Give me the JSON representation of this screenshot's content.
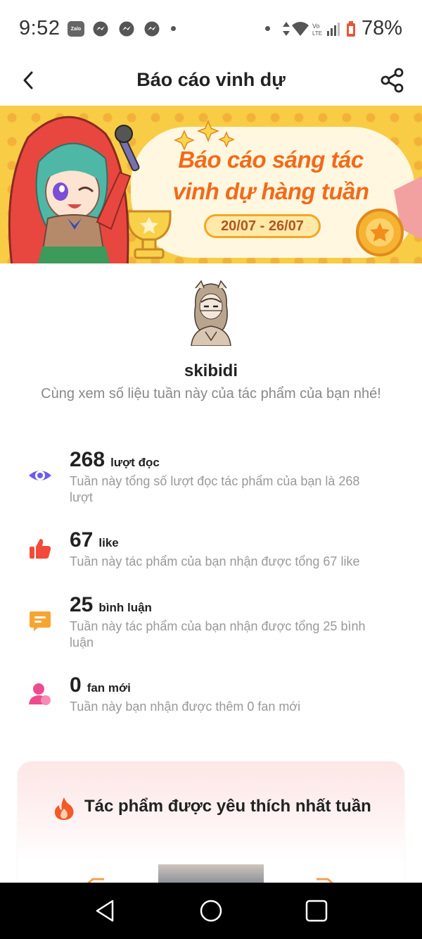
{
  "status_bar": {
    "time": "9:52",
    "battery": "78%",
    "notification_icons": [
      "zalo-icon",
      "messenger-icon",
      "messenger-icon",
      "messenger-icon"
    ],
    "zalo_label": "Zalo"
  },
  "header": {
    "title": "Báo cáo vinh dự"
  },
  "banner": {
    "title_line1": "Báo cáo sáng tác",
    "title_line2": "vinh dự hàng tuần",
    "date_range": "20/07 - 26/07"
  },
  "profile": {
    "username": "skibidi",
    "subtitle": "Cùng xem số liệu tuần này của tác phẩm của bạn nhé!"
  },
  "stats": [
    {
      "icon": "eye-icon",
      "value": "268",
      "unit": "lượt đọc",
      "description": "Tuần này tổng số lượt đọc tác phẩm của bạn là 268 lượt",
      "color": "#6b5cf0"
    },
    {
      "icon": "thumbs-up-icon",
      "value": "67",
      "unit": "like",
      "description": "Tuần này tác phẩm của bạn nhận được tổng 67 like",
      "color": "#f24b3c"
    },
    {
      "icon": "comment-icon",
      "value": "25",
      "unit": "bình luận",
      "description": "Tuần này tác phẩm của bạn nhận được tổng 25 bình luận",
      "color": "#f7a531"
    },
    {
      "icon": "user-icon",
      "value": "0",
      "unit": "fan mới",
      "description": "Tuần này bạn nhận được thêm 0 fan mới",
      "color": "#ec4c8c"
    }
  ],
  "favorite": {
    "title": "Tác phẩm được yêu thích nhất tuần"
  }
}
